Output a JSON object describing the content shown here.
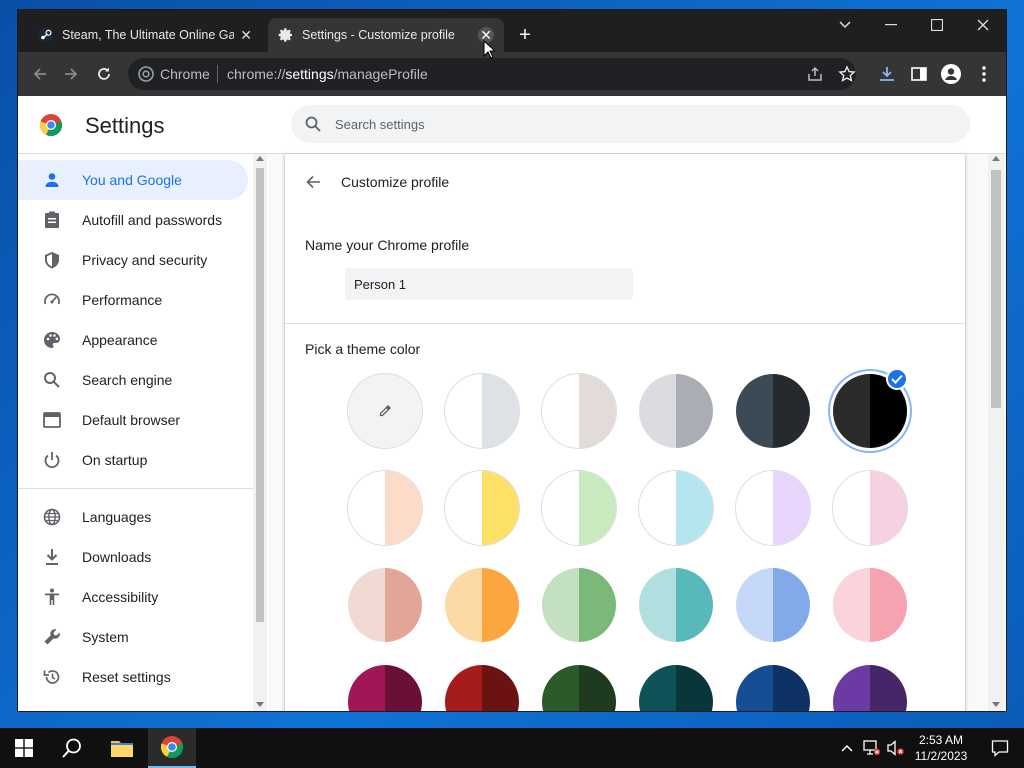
{
  "tabs": [
    {
      "title": "Steam, The Ultimate Online Game Platform",
      "icon": "steam-icon"
    },
    {
      "title": "Settings - Customize profile",
      "icon": "gear-icon",
      "active": true
    }
  ],
  "omnibox": {
    "site_label": "Chrome",
    "url_scheme": "chrome://",
    "url_host": "settings",
    "url_path": "/manageProfile"
  },
  "settings": {
    "title": "Settings",
    "search_placeholder": "Search settings"
  },
  "sidebar": {
    "items": [
      {
        "label": "You and Google",
        "icon": "person-icon",
        "selected": true
      },
      {
        "label": "Autofill and passwords",
        "icon": "clipboard-icon"
      },
      {
        "label": "Privacy and security",
        "icon": "shield-icon"
      },
      {
        "label": "Performance",
        "icon": "gauge-icon"
      },
      {
        "label": "Appearance",
        "icon": "palette-icon"
      },
      {
        "label": "Search engine",
        "icon": "search-icon"
      },
      {
        "label": "Default browser",
        "icon": "browser-icon"
      },
      {
        "label": "On startup",
        "icon": "power-icon"
      },
      {
        "label": "Languages",
        "icon": "globe-icon"
      },
      {
        "label": "Downloads",
        "icon": "download-icon"
      },
      {
        "label": "Accessibility",
        "icon": "accessibility-icon"
      },
      {
        "label": "System",
        "icon": "wrench-icon"
      },
      {
        "label": "Reset settings",
        "icon": "reset-icon"
      }
    ]
  },
  "profile": {
    "back_label": "Customize profile",
    "name_label": "Name your Chrome profile",
    "name_value": "Person 1",
    "theme_label": "Pick a theme color"
  },
  "theme_colors": [
    [
      [
        "#f3f3f3",
        "#f3f3f3"
      ],
      [
        "#ffffff",
        "#dee1e6"
      ],
      [
        "#ffffff",
        "#e3dbd8"
      ],
      [
        "#dadce0",
        "#aaadb4"
      ],
      [
        "#3c4a55",
        "#26292e"
      ],
      [
        "#2b2b2b",
        "#000000"
      ]
    ],
    [
      [
        "#ffffff",
        "#fcdbc9"
      ],
      [
        "#ffffff",
        "#fde166"
      ],
      [
        "#ffffff",
        "#c9eabf"
      ],
      [
        "#ffffff",
        "#b5e6f0"
      ],
      [
        "#ffffff",
        "#e7d5fb"
      ],
      [
        "#ffffff",
        "#f6d1e1"
      ]
    ],
    [
      [
        "#f1dad4",
        "#e3a595"
      ],
      [
        "#fdd9a6",
        "#fca640"
      ],
      [
        "#c3e1c0",
        "#7ab978"
      ],
      [
        "#b1dfe0",
        "#59b8bc"
      ],
      [
        "#c6d8f7",
        "#82a9e9"
      ],
      [
        "#fbd3da",
        "#f6a2b1"
      ]
    ],
    [
      [
        "#a11656",
        "#6a0f38"
      ],
      [
        "#a61c1c",
        "#6b1212"
      ],
      [
        "#2b5a2b",
        "#1f3b1f"
      ],
      [
        "#0d5358",
        "#08363a"
      ],
      [
        "#164e96",
        "#0e3263"
      ],
      [
        "#6b3aa3",
        "#452668"
      ]
    ]
  ],
  "selected_theme": {
    "row": 0,
    "col": 5
  },
  "taskbar": {
    "time": "2:53 AM",
    "date": "11/2/2023"
  }
}
